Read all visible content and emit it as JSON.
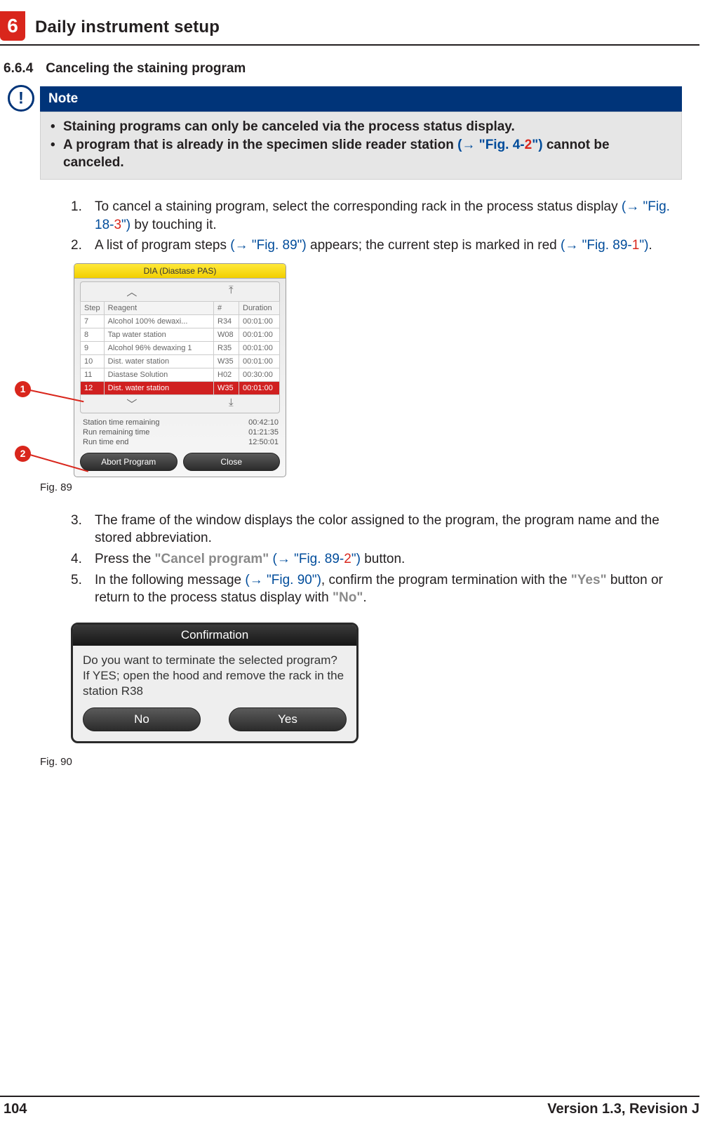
{
  "header": {
    "chapter_number": "6",
    "chapter_title": "Daily instrument setup"
  },
  "section": {
    "number": "6.6.4",
    "title": "Canceling the staining program"
  },
  "note": {
    "label": "Note",
    "bullets": [
      {
        "text": "Staining programs can only be canceled via the process status display."
      },
      {
        "pre": "A program that is already in the specimen slide reader station ",
        "ref": "(→ \"Fig. 4-",
        "rednum": "2",
        "reftail": "\")",
        "post": " cannot be canceled."
      }
    ]
  },
  "steps_a": [
    {
      "pre": "To cancel a staining program, select the corresponding rack in the process status display ",
      "ref": "(→ \"Fig. 18-",
      "rednum": "3",
      "reftail": "\")",
      "post": " by touching it."
    },
    {
      "pre": "A list of program steps ",
      "ref1": "(→ \"Fig. 89\")",
      "mid": " appears; the current step is marked in red ",
      "ref2": "(→ \"Fig. 89-",
      "rednum": "1",
      "reftail": "\")",
      "post": "."
    }
  ],
  "fig89": {
    "title": "DIA (Diastase PAS)",
    "headers": {
      "step": "Step",
      "reagent": "Reagent",
      "num": "#",
      "duration": "Duration"
    },
    "rows": [
      {
        "step": "7",
        "reagent": "Alcohol 100% dewaxi...",
        "num": "R34",
        "dur": "00:01:00"
      },
      {
        "step": "8",
        "reagent": "Tap water station",
        "num": "W08",
        "dur": "00:01:00"
      },
      {
        "step": "9",
        "reagent": "Alcohol 96% dewaxing 1",
        "num": "R35",
        "dur": "00:01:00"
      },
      {
        "step": "10",
        "reagent": "Dist. water station",
        "num": "W35",
        "dur": "00:01:00"
      },
      {
        "step": "11",
        "reagent": "Diastase Solution",
        "num": "H02",
        "dur": "00:30:00"
      },
      {
        "step": "12",
        "reagent": "Dist. water station",
        "num": "W35",
        "dur": "00:01:00",
        "hl": true
      }
    ],
    "times": {
      "l1": "Station time remaining",
      "v1": "00:42:10",
      "l2": "Run remaining time",
      "v2": "01:21:35",
      "l3": "Run time end",
      "v3": "12:50:01"
    },
    "btn_abort": "Abort Program",
    "btn_close": "Close",
    "callouts": {
      "c1": "1",
      "c2": "2"
    },
    "caption": "Fig. 89"
  },
  "steps_b": [
    {
      "text": "The frame of the window displays the color assigned to the program, the program name and the stored abbreviation."
    },
    {
      "pre": "Press the ",
      "gq": "\"Cancel program\"",
      "sp": " ",
      "ref": "(→ \"Fig. 89-",
      "rednum": "2",
      "reftail": "\")",
      "post": " button."
    },
    {
      "pre": "In the following message ",
      "ref1": "(→ \"Fig. 90\")",
      "mid": ", confirm the program termination with the ",
      "gq1": "\"Yes\"",
      "mid2": " button or return to the process status display with ",
      "gq2": "\"No\"",
      "post": "."
    }
  ],
  "fig90": {
    "title": "Confirmation",
    "body": "Do you want to terminate the selected program? If YES; open the hood and remove the rack in the station R38",
    "no": "No",
    "yes": "Yes",
    "caption": "Fig. 90"
  },
  "footer": {
    "page": "104",
    "version": "Version 1.3, Revision J"
  }
}
